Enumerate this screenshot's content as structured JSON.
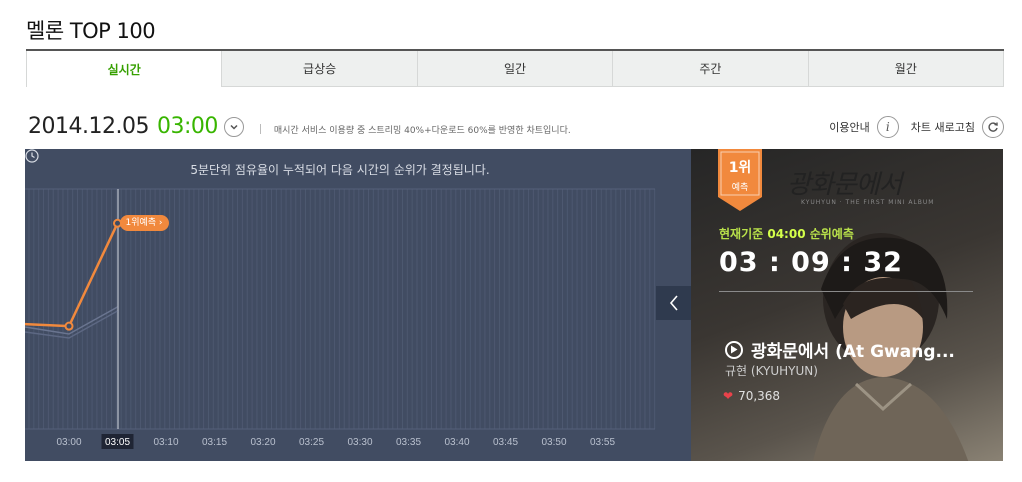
{
  "title": "멜론 TOP 100",
  "tabs": [
    {
      "label": "실시간",
      "active": true
    },
    {
      "label": "급상승",
      "active": false
    },
    {
      "label": "일간",
      "active": false
    },
    {
      "label": "주간",
      "active": false
    },
    {
      "label": "월간",
      "active": false
    }
  ],
  "date": "2014.12.05",
  "time": "03:00",
  "notice": "매시간 서비스 이용량 중 스트리밍 40%+다운로드 60%를 반영한 차트입니다.",
  "tools": {
    "info_label": "이용안내",
    "refresh_label": "차트 새로고침"
  },
  "chart": {
    "notice": "5분단위 점유율이 누적되어 다음 시간의 순위가 결정됩니다.",
    "x_labels": [
      "03:00",
      "03:05",
      "03:10",
      "03:15",
      "03:20",
      "03:25",
      "03:30",
      "03:35",
      "03:40",
      "03:45",
      "03:50",
      "03:55"
    ],
    "active_label": "03:05",
    "badge": "1위예측 ›"
  },
  "chart_data": {
    "type": "line",
    "categories": [
      "03:00",
      "03:05",
      "03:10",
      "03:15",
      "03:20",
      "03:25",
      "03:30",
      "03:35",
      "03:40",
      "03:45",
      "03:50",
      "03:55"
    ],
    "series": [
      {
        "values": [
          4,
          1,
          null,
          null,
          null,
          null,
          null,
          null,
          null,
          null,
          null,
          null
        ],
        "color": "#f1893d"
      }
    ],
    "ylim": [
      0,
      7
    ],
    "title": "",
    "xlabel": "",
    "ylabel": "",
    "grid": true
  },
  "side": {
    "rank": "1위",
    "rank_sub": "예측",
    "logo_text": "광화문에서",
    "logo_sub": "KYUHYUN · THE FIRST MINI ALBUM",
    "basis_prefix": "현재기준 ",
    "basis_time": "04:00",
    "basis_suffix": " 순위예측",
    "countdown": "03 : 09 : 32",
    "song": "광화문에서 (At Gwang...",
    "artist": "규현 (KYUHYUN)",
    "likes": "70,368"
  },
  "colors": {
    "accent_green": "#38b500",
    "chart_bg": "#414c62",
    "line_orange": "#f1893d",
    "heart": "#e8424a"
  }
}
